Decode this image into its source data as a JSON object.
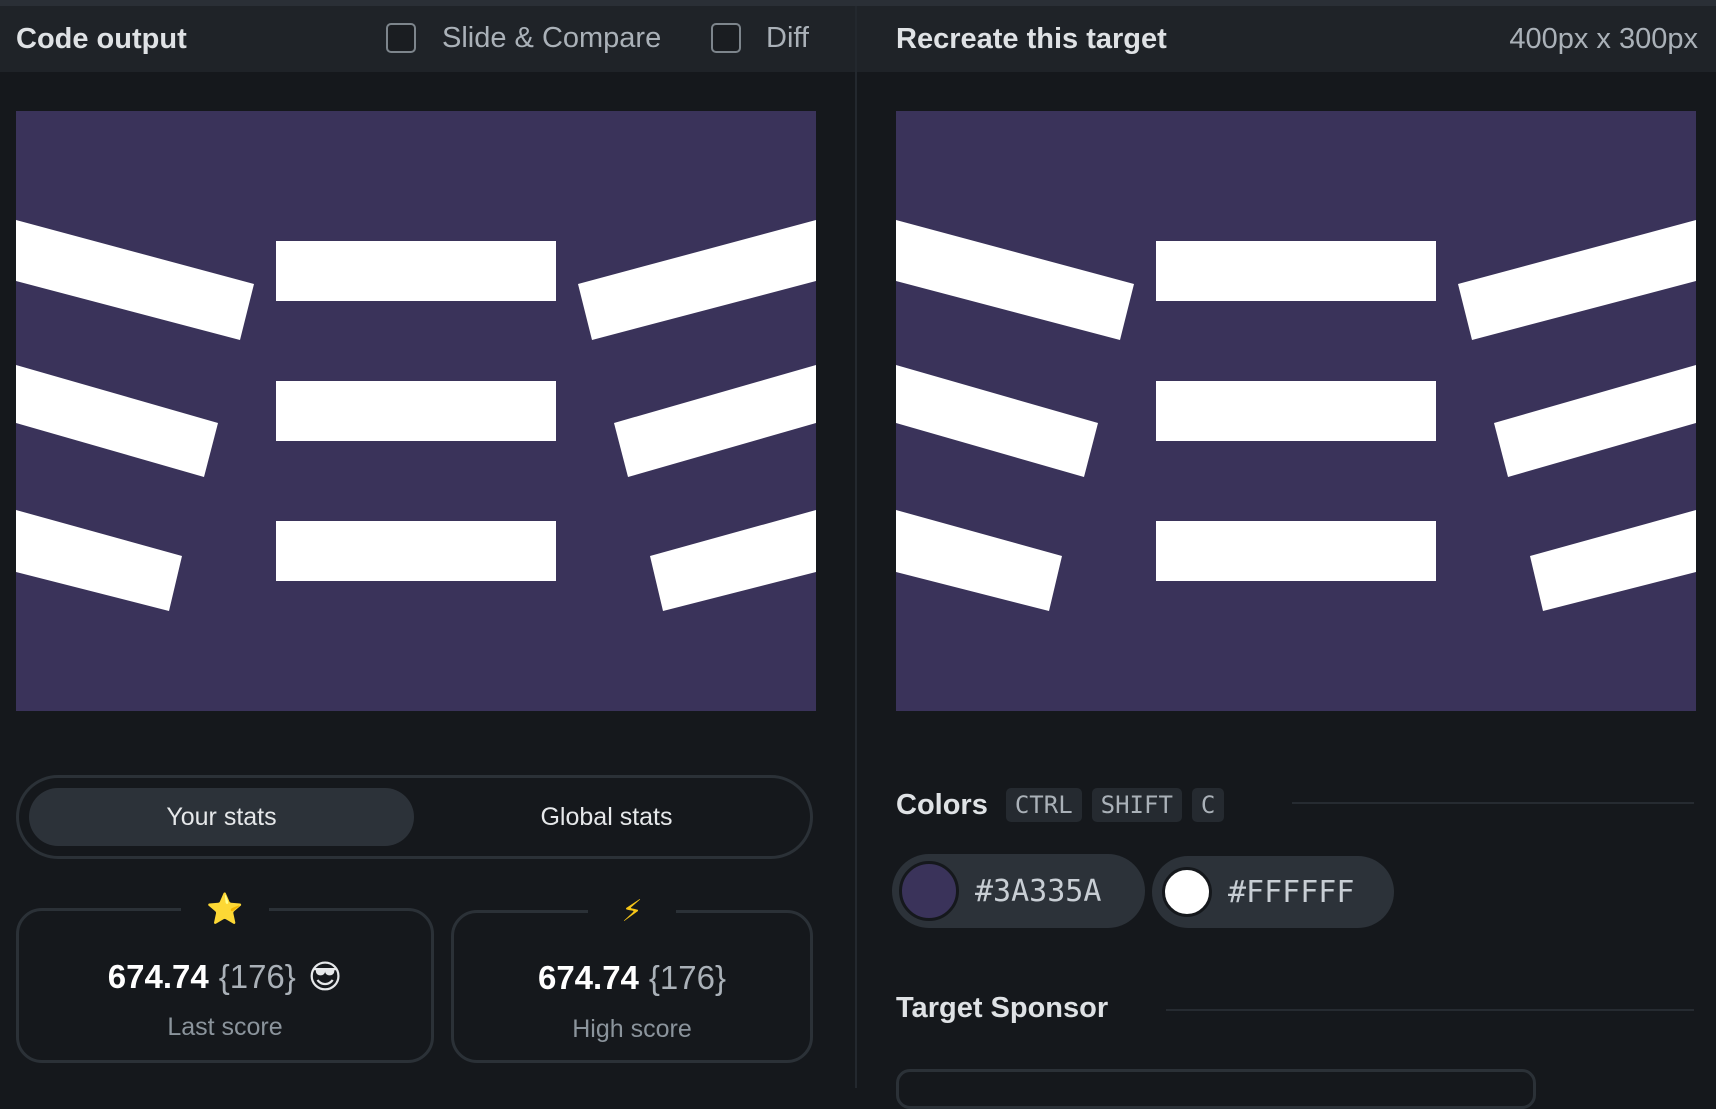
{
  "left_panel": {
    "title": "Code output",
    "slide_compare_label": "Slide & Compare",
    "diff_label": "Diff",
    "stats_toggle": {
      "active": "Your stats",
      "inactive": "Global stats"
    },
    "stats": [
      {
        "icon": "star-icon",
        "glyph": "⭐",
        "score": "674.74",
        "count": "{176}",
        "emoji": "😎",
        "label": "Last score"
      },
      {
        "icon": "lightning-icon",
        "glyph": "⚡",
        "score": "674.74",
        "count": "{176}",
        "label": "High score"
      }
    ]
  },
  "right_panel": {
    "title": "Recreate this target",
    "dimensions": "400px x 300px",
    "colors_title": "Colors",
    "shortcut_keys": [
      "CTRL",
      "SHIFT",
      "C"
    ],
    "swatches": [
      {
        "hex": "#3A335A",
        "color": "#3A335A"
      },
      {
        "hex": "#FFFFFF",
        "color": "#FFFFFF"
      }
    ],
    "sponsor_title": "Target Sponsor"
  },
  "target_colors": {
    "background": "#3A335A",
    "foreground": "#FFFFFF"
  }
}
